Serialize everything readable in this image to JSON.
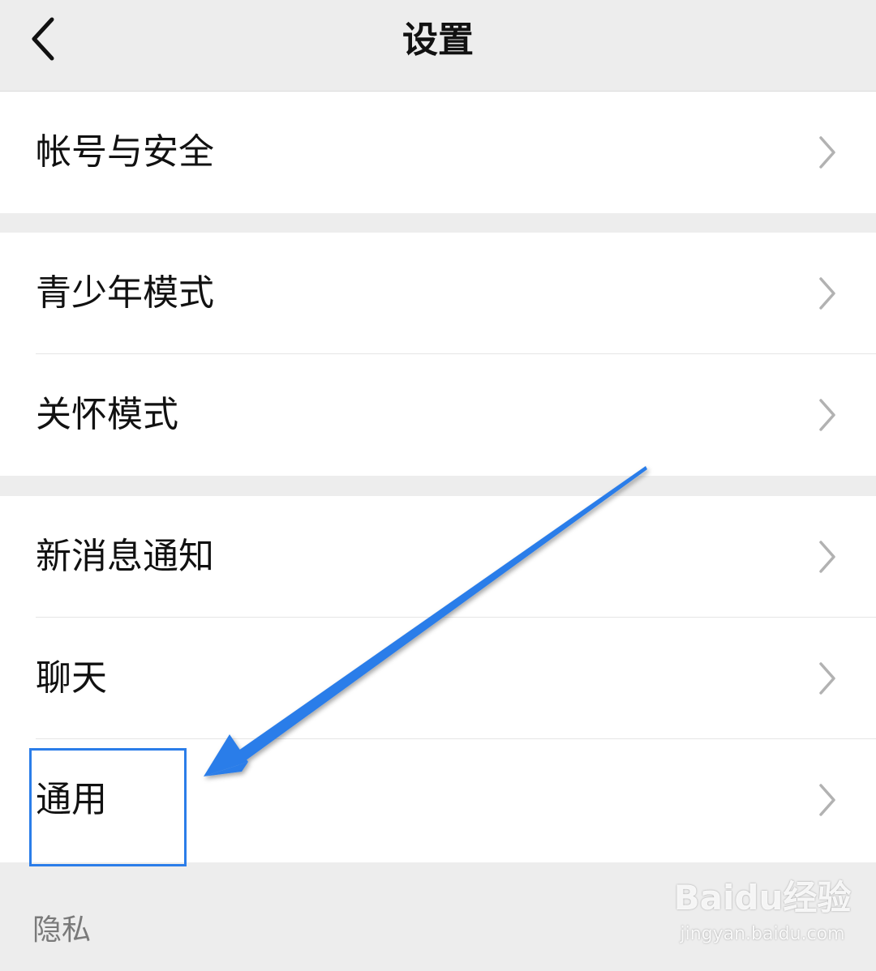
{
  "header": {
    "title": "设置",
    "back_icon": "chevron-left-icon"
  },
  "groups": [
    {
      "items": [
        {
          "label": "帐号与安全"
        }
      ]
    },
    {
      "items": [
        {
          "label": "青少年模式"
        },
        {
          "label": "关怀模式"
        }
      ]
    },
    {
      "items": [
        {
          "label": "新消息通知"
        },
        {
          "label": "聊天"
        },
        {
          "label": "通用"
        }
      ]
    }
  ],
  "section_label": "隐私",
  "annotation": {
    "highlighted_item": "通用",
    "color": "#2b7de9"
  },
  "watermark": {
    "main": "Baidu经验",
    "sub": "jingyan.baidu.com"
  },
  "colors": {
    "background": "#ededed",
    "row_background": "#ffffff",
    "text": "#111111",
    "chevron": "#b2b2b2"
  }
}
